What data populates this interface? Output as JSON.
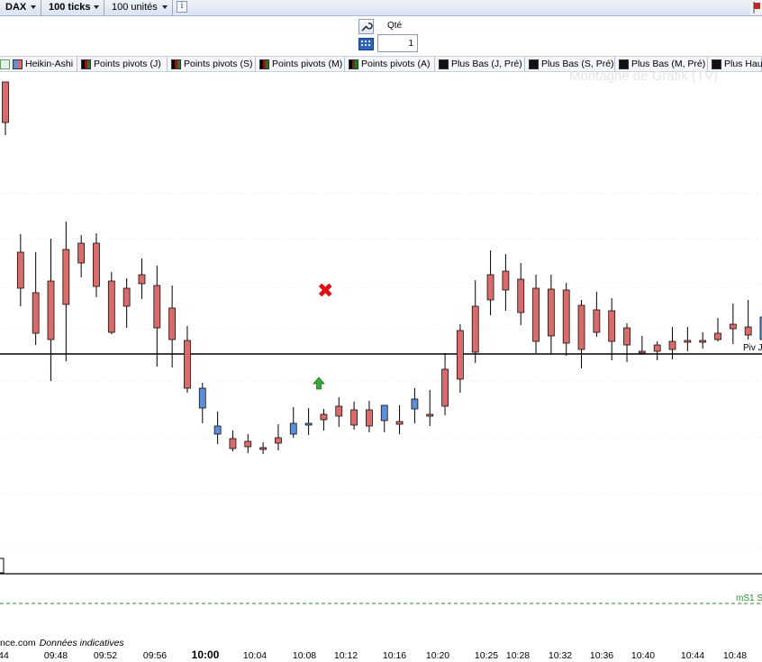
{
  "toolbar": {
    "instrument": "DAX",
    "period": "100 ticks",
    "units": "100 unités",
    "info_icon": "info-icon"
  },
  "order_ticket": {
    "qty_label": "Qté",
    "qty_value": "1",
    "icons": [
      "wrench-icon",
      "keypad-icon"
    ]
  },
  "legend": {
    "items": [
      {
        "label": "Heikin-Ashi",
        "icon": "heikin-ashi-icon",
        "colors": [
          "#5b8fd9",
          "#d96b6b"
        ]
      },
      {
        "label": "Points pivots (J)",
        "icon": "pivot-icon",
        "colors": [
          "#000000",
          "#8b1a1a",
          "#1e7a1e"
        ]
      },
      {
        "label": "Points pivots (S)",
        "icon": "pivot-icon",
        "colors": [
          "#000000",
          "#8b1a1a",
          "#1e7a1e"
        ]
      },
      {
        "label": "Points pivots (M)",
        "icon": "pivot-icon",
        "colors": [
          "#000000",
          "#8b1a1a",
          "#1e7a1e"
        ]
      },
      {
        "label": "Points pivots (A)",
        "icon": "pivot-icon",
        "colors": [
          "#000000",
          "#8b1a1a",
          "#1e7a1e"
        ]
      },
      {
        "label": "Plus Bas (J, Pré)",
        "icon": "square-black-icon",
        "colors": [
          "#111111"
        ]
      },
      {
        "label": "Plus Bas (S, Pré)",
        "icon": "square-black-icon",
        "colors": [
          "#111111"
        ]
      },
      {
        "label": "Plus Bas (M, Pré)",
        "icon": "square-black-icon",
        "colors": [
          "#111111"
        ]
      },
      {
        "label": "Plus Hau",
        "icon": "square-black-icon",
        "colors": [
          "#111111"
        ]
      }
    ]
  },
  "watermark": "Montagne de Grafik (TV)",
  "source": {
    "site": "nce.com",
    "note": "Données indicatives"
  },
  "chart_data": {
    "type": "candlestick",
    "style": "heikin-ashi",
    "colors": {
      "up": "#5b8fd9",
      "down": "#d96b6b",
      "wick": "#000000",
      "pivot": "#000000",
      "support": "#2e8b2e"
    },
    "x_ticks": [
      "44",
      "09:48",
      "09:52",
      "09:56",
      "10:00",
      "10:04",
      "10:08",
      "10:12",
      "10:16",
      "10:20",
      "10:25",
      "10:28",
      "10:32",
      "10:36",
      "10:40",
      "10:44",
      "10:48"
    ],
    "bold_tick": "10:00",
    "lines": [
      {
        "label": "Piv J",
        "style": "solid"
      },
      {
        "label": "mS1 S",
        "style": "dashed"
      }
    ],
    "markers": [
      {
        "type": "sell",
        "icon": "red-x-icon",
        "bar": 52
      },
      {
        "type": "buy",
        "icon": "green-up-arrow-icon",
        "bar": 50
      }
    ],
    "bars": [
      {
        "o": 11,
        "c": 56,
        "h": 48,
        "l": 70
      },
      {
        "o": 200,
        "c": 240,
        "h": 180,
        "l": 260
      },
      {
        "o": 245,
        "c": 290,
        "h": 200,
        "l": 303
      },
      {
        "o": 232,
        "c": 297,
        "h": 185,
        "l": 343
      },
      {
        "o": 197,
        "c": 258,
        "h": 166,
        "l": 321
      },
      {
        "o": 190,
        "c": 212,
        "h": 181,
        "l": 228
      },
      {
        "o": 190,
        "c": 238,
        "h": 179,
        "l": 250
      },
      {
        "o": 232,
        "c": 289,
        "h": 222,
        "l": 291
      },
      {
        "o": 240,
        "c": 260,
        "h": 229,
        "l": 284
      },
      {
        "o": 225,
        "c": 235,
        "h": 207,
        "l": 252
      },
      {
        "o": 237,
        "c": 284,
        "h": 215,
        "l": 327
      },
      {
        "o": 262,
        "c": 297,
        "h": 237,
        "l": 328
      },
      {
        "o": 298,
        "c": 351,
        "h": 282,
        "l": 356
      },
      {
        "o": 373,
        "c": 351,
        "h": 345,
        "l": 390
      },
      {
        "o": 402,
        "c": 393,
        "h": 377,
        "l": 413
      },
      {
        "o": 407,
        "c": 418,
        "h": 398,
        "l": 421
      },
      {
        "o": 410,
        "c": 416,
        "h": 402,
        "l": 423
      },
      {
        "o": 417,
        "c": 419,
        "h": 411,
        "l": 424
      },
      {
        "o": 406,
        "c": 412,
        "h": 391,
        "l": 420
      },
      {
        "o": 402,
        "c": 390,
        "h": 372,
        "l": 406
      },
      {
        "o": 391,
        "c": 390,
        "h": 373,
        "l": 403
      },
      {
        "o": 380,
        "c": 386,
        "h": 374,
        "l": 398
      },
      {
        "o": 371,
        "c": 382,
        "h": 361,
        "l": 394
      },
      {
        "o": 375,
        "c": 392,
        "h": 366,
        "l": 397
      },
      {
        "o": 375,
        "c": 393,
        "h": 365,
        "l": 400
      },
      {
        "o": 387,
        "c": 370,
        "h": 372,
        "l": 400
      },
      {
        "o": 388,
        "c": 391,
        "h": 370,
        "l": 402
      },
      {
        "o": 374,
        "c": 363,
        "h": 351,
        "l": 390
      },
      {
        "o": 380,
        "c": 380,
        "h": 353,
        "l": 393
      },
      {
        "o": 330,
        "c": 371,
        "h": 312,
        "l": 381
      },
      {
        "o": 287,
        "c": 341,
        "h": 280,
        "l": 356
      },
      {
        "o": 260,
        "c": 311,
        "h": 231,
        "l": 323
      },
      {
        "o": 225,
        "c": 253,
        "h": 198,
        "l": 270
      },
      {
        "o": 221,
        "c": 242,
        "h": 202,
        "l": 265
      },
      {
        "o": 230,
        "c": 267,
        "h": 212,
        "l": 281
      },
      {
        "o": 240,
        "c": 299,
        "h": 225,
        "l": 312
      },
      {
        "o": 241,
        "c": 293,
        "h": 225,
        "l": 313
      },
      {
        "o": 242,
        "c": 301,
        "h": 234,
        "l": 315
      },
      {
        "o": 259,
        "c": 308,
        "h": 253,
        "l": 329
      },
      {
        "o": 264,
        "c": 289,
        "h": 244,
        "l": 294
      },
      {
        "o": 265,
        "c": 299,
        "h": 251,
        "l": 320
      },
      {
        "o": 284,
        "c": 303,
        "h": 279,
        "l": 322
      },
      {
        "o": 310,
        "c": 311,
        "h": 293,
        "l": 312
      },
      {
        "o": 303,
        "c": 310,
        "h": 299,
        "l": 320
      },
      {
        "o": 299,
        "c": 308,
        "h": 283,
        "l": 319
      },
      {
        "o": 298,
        "c": 299,
        "h": 283,
        "l": 310
      },
      {
        "o": 298,
        "c": 300,
        "h": 289,
        "l": 307
      },
      {
        "o": 290,
        "c": 297,
        "h": 273,
        "l": 299
      },
      {
        "o": 280,
        "c": 285,
        "h": 257,
        "l": 302
      },
      {
        "o": 283,
        "c": 292,
        "h": 253,
        "l": 297
      },
      {
        "o": 297,
        "c": 272,
        "h": 287,
        "l": 339
      }
    ]
  }
}
